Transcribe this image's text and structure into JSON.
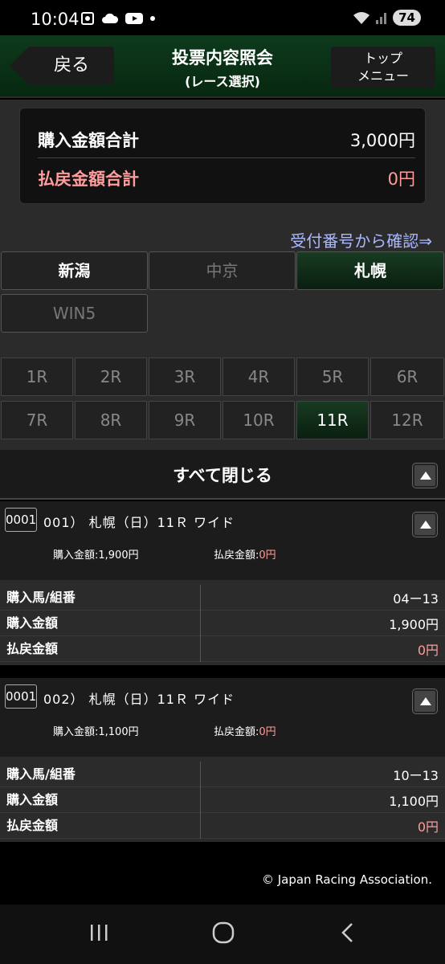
{
  "status_bar": {
    "time": "10:04",
    "battery": "74"
  },
  "header": {
    "back": "戻る",
    "title": "投票内容照会",
    "subtitle": "(レース選択)",
    "top_line1": "トップ",
    "top_line2": "メニュー"
  },
  "summary": {
    "purchase_label": "購入金額合計",
    "purchase_value": "3,000円",
    "refund_label": "払戻金額合計",
    "refund_value": "0円"
  },
  "confirm_link": "受付番号から確認⇒",
  "venues": [
    "新潟",
    "中京",
    "札幌",
    "WIN5"
  ],
  "races": [
    "1R",
    "2R",
    "3R",
    "4R",
    "5R",
    "6R",
    "7R",
    "8R",
    "9R",
    "10R",
    "11R",
    "12R"
  ],
  "close_all": "すべて閉じる",
  "bets": [
    {
      "ticket": "0001",
      "title": "001） 札幌（日）11Ｒ ワイド",
      "purchase_sub": "購入金額:1,900円",
      "refund_sub_label": "払戻金額:",
      "refund_sub_value": "0円",
      "rows": [
        {
          "key": "購入馬/組番",
          "value": "04ー13"
        },
        {
          "key": "購入金額",
          "value": "1,900円"
        },
        {
          "key": "払戻金額",
          "value": "0円"
        }
      ]
    },
    {
      "ticket": "0001",
      "title": "002） 札幌（日）11Ｒ ワイド",
      "purchase_sub": "購入金額:1,100円",
      "refund_sub_label": "払戻金額:",
      "refund_sub_value": "0円",
      "rows": [
        {
          "key": "購入馬/組番",
          "value": "10ー13"
        },
        {
          "key": "購入金額",
          "value": "1,100円"
        },
        {
          "key": "払戻金額",
          "value": "0円"
        }
      ]
    }
  ],
  "footer": "© Japan Racing Association."
}
